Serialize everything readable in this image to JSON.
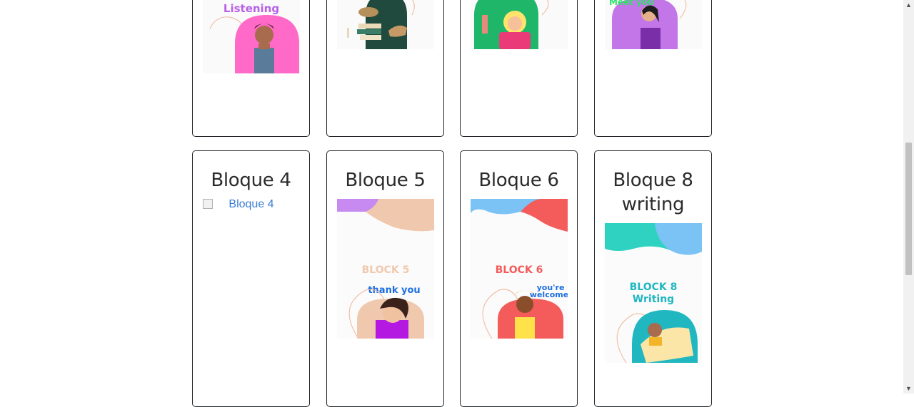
{
  "cards_top": [
    {
      "id": "listening",
      "image_text": "Listening",
      "accent": "#f15fca",
      "bg": "#ffffff"
    },
    {
      "id": "reading",
      "image_text": "",
      "accent": "#1f4a3d",
      "bg": "#ffffff"
    },
    {
      "id": "hello",
      "image_text": "",
      "accent": "#e23a6b",
      "bg": "#ffffff"
    },
    {
      "id": "meet-you",
      "image_text": "Meet you",
      "accent": "#c276e8",
      "bg": "#ffffff"
    }
  ],
  "cards_bottom": [
    {
      "id": "bloque4",
      "title": "Bloque 4",
      "image_alt": "Bloque 4"
    },
    {
      "id": "bloque5",
      "title": "Bloque 5",
      "image_text": [
        "BLOCK 5",
        "thank you"
      ],
      "accent": "#f0c8ad",
      "blob": "#c68af0"
    },
    {
      "id": "bloque6",
      "title": "Bloque 6",
      "image_text": [
        "BLOCK 6",
        "you're",
        "welcome"
      ],
      "accent": "#f45b5b",
      "blob": "#7cc3f5"
    },
    {
      "id": "bloque8",
      "title": [
        "Bloque 8",
        "writing"
      ],
      "image_text": [
        "BLOCK 8",
        "Writing"
      ],
      "accent": "#20b7c1",
      "blob": "#2fd2c0"
    }
  ],
  "colors": {
    "border": "#212529",
    "link": "#3a7bd5",
    "scrollbar": "#c1c1c1"
  }
}
